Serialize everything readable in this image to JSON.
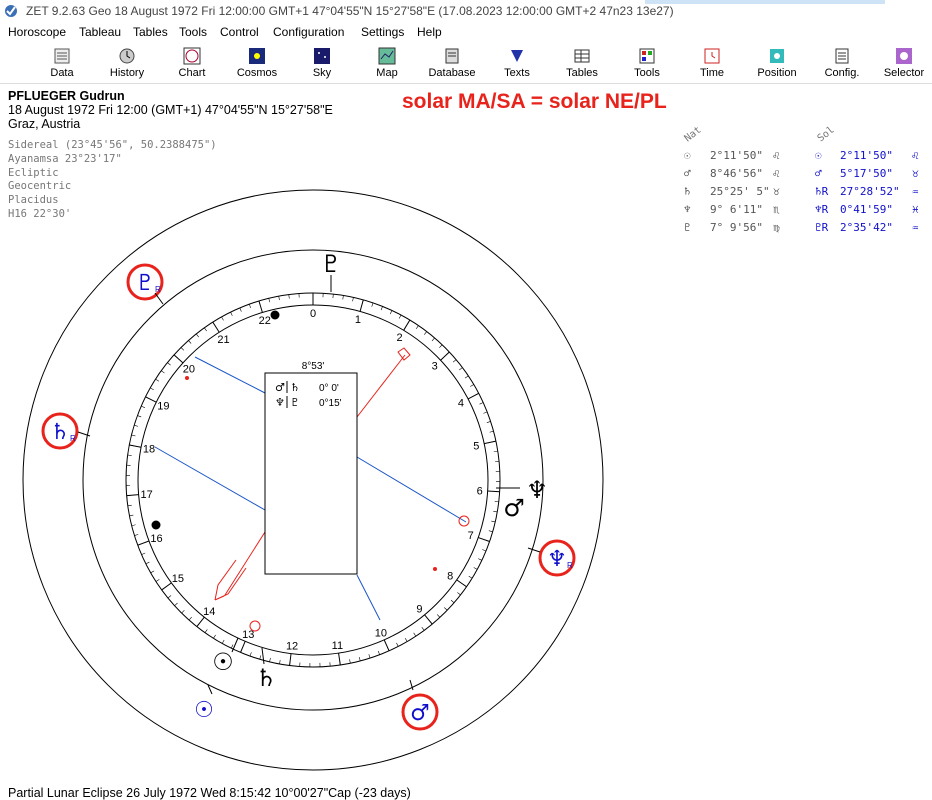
{
  "window": {
    "title": "ZET 9.2.63 Geo    18 August 1972  Fri  12:00:00 GMT+1 47°04'55\"N  15°27'58\"E  (17.08.2023  12:00:00 GMT+2 47n23 13e27)"
  },
  "menu": [
    "Horoscope",
    "Tableau",
    "Tables",
    "Tools",
    "Control",
    "Configuration",
    "Settings",
    "Help"
  ],
  "toolbar": [
    {
      "label": "Data",
      "icon": "data-icon"
    },
    {
      "label": "History",
      "icon": "history-icon"
    },
    {
      "label": "Chart",
      "icon": "chart-icon"
    },
    {
      "label": "Cosmos",
      "icon": "cosmos-icon"
    },
    {
      "label": "Sky",
      "icon": "sky-icon"
    },
    {
      "label": "Map",
      "icon": "map-icon"
    },
    {
      "label": "Database",
      "icon": "database-icon"
    },
    {
      "label": "Texts",
      "icon": "texts-icon"
    },
    {
      "label": "Tables",
      "icon": "tables-icon"
    },
    {
      "label": "Tools",
      "icon": "tools-icon"
    },
    {
      "label": "Time",
      "icon": "time-icon"
    },
    {
      "label": "Position",
      "icon": "position-icon"
    },
    {
      "label": "Config.",
      "icon": "config-icon"
    },
    {
      "label": "Selector",
      "icon": "selector-icon"
    }
  ],
  "person": {
    "name": "PFLUEGER Gudrun",
    "datetime": "18 August 1972  Fri  12:00 (GMT+1) 47°04'55\"N  15°27'58\"E",
    "place": "Graz, Austria"
  },
  "settings": [
    "Sidereal (23°45'56\", 50.2388475\")",
    "Ayanamsa 23°23'17\"",
    "Ecliptic",
    "Geocentric",
    "Placidus",
    "H16  22°30'"
  ],
  "headline": "solar MA/SA = solar NE/PL",
  "table": {
    "headers": {
      "nat": "Nat",
      "sol": "Sol"
    },
    "rows": [
      {
        "glyph": "☉",
        "nat": "2°11'50\"",
        "natsign": "♌",
        "solglyph": "☉",
        "sol": "2°11'50\"",
        "solsign": "♌"
      },
      {
        "glyph": "♂",
        "nat": "8°46'56\"",
        "natsign": "♌",
        "solglyph": "♂",
        "sol": "5°17'50\"",
        "solsign": "♉"
      },
      {
        "glyph": "♄",
        "nat": "25°25' 5\"",
        "natsign": "♉",
        "solglyph": "♄R",
        "sol": "27°28'52\"",
        "solsign": "♒"
      },
      {
        "glyph": "♆",
        "nat": "9° 6'11\"",
        "natsign": "♏",
        "solglyph": "♆R",
        "sol": "0°41'59\"",
        "solsign": "♓"
      },
      {
        "glyph": "♇",
        "nat": "7° 9'56\"",
        "natsign": "♍",
        "solglyph": "♇R",
        "sol": "2°35'42\"",
        "solsign": "♒"
      }
    ]
  },
  "center_box": {
    "title": "8°53'",
    "rows": [
      {
        "left": "♂",
        "mid": "♄",
        "value": "0° 0'"
      },
      {
        "left": "♆",
        "mid": "♇",
        "value": "0°15'"
      }
    ]
  },
  "dial_numbers": [
    "0",
    "1",
    "2",
    "3",
    "4",
    "5",
    "6",
    "7",
    "8",
    "9",
    "10",
    "11",
    "12",
    "13",
    "14",
    "15",
    "16",
    "17",
    "18",
    "19",
    "20",
    "21",
    "22"
  ],
  "inner_glyphs": [
    {
      "name": "pluto",
      "text": "♇"
    },
    {
      "name": "neptune",
      "text": "♆"
    },
    {
      "name": "mars",
      "text": "♂"
    },
    {
      "name": "sun",
      "text": "☉"
    },
    {
      "name": "saturn",
      "text": "♄"
    }
  ],
  "outer_glyphs": [
    {
      "name": "pluto",
      "text": "♇",
      "sub": "R"
    },
    {
      "name": "saturn",
      "text": "♄",
      "sub": "R"
    },
    {
      "name": "neptune",
      "text": "♆",
      "sub": "R"
    },
    {
      "name": "sun",
      "text": "☉",
      "sub": ""
    },
    {
      "name": "mars",
      "text": "♂",
      "sub": ""
    }
  ],
  "colors": {
    "accent": "#e8231c",
    "solar": "#1010cc",
    "line": "#1a55c8",
    "dark": "#000000"
  },
  "footer": "Partial Lunar Eclipse 26 July 1972 Wed  8:15:42 10°00'27\"Cap (-23 days)"
}
